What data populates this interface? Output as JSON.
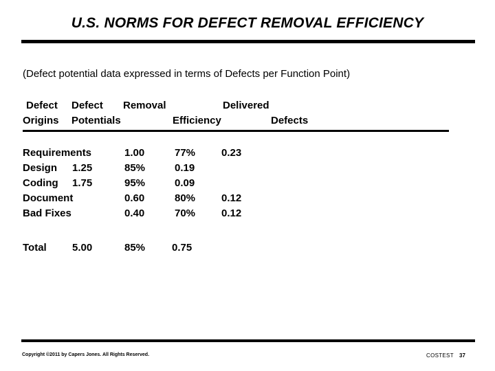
{
  "slide": {
    "title": "U.S. NORMS FOR DEFECT REMOVAL EFFICIENCY",
    "subtitle": "(Defect potential data expressed in terms of Defects per Function Point)",
    "background_color": "#ffffff",
    "text_color": "#000000"
  },
  "table": {
    "headers": {
      "row1": [
        "Defect",
        "Defect",
        "Removal",
        "Delivered"
      ],
      "row2": [
        "Origins",
        "Potentials",
        "Efficiency",
        "Defects"
      ],
      "col1_label": "Defect Origins",
      "col2_label": "Defect Potentials",
      "col3_label": "Removal Efficiency",
      "col4_label": "Delivered Defects"
    },
    "rows": [
      {
        "origin": "Requirements",
        "potential": "1.00",
        "efficiency": "77%",
        "delivered": "0.23",
        "inline_potential": false
      },
      {
        "origin": "Design",
        "potential": "1.25",
        "efficiency": "85%",
        "delivered": "0.19",
        "inline_potential": true
      },
      {
        "origin": "Coding",
        "potential": "1.75",
        "efficiency": "95%",
        "delivered": "0.09",
        "inline_potential": true
      },
      {
        "origin": "Document",
        "potential": "0.60",
        "efficiency": "80%",
        "delivered": "0.12",
        "inline_potential": false
      },
      {
        "origin": "Bad Fixes",
        "potential": "0.40",
        "efficiency": "70%",
        "delivered": "0.12",
        "inline_potential": false
      }
    ],
    "total": {
      "label": "Total",
      "potential": "5.00",
      "efficiency": "85%",
      "delivered": "0.75"
    }
  },
  "footer": {
    "copyright": "Copyright ©2011 by Capers Jones.  All Rights Reserved.",
    "document_code": "COSTEST",
    "page_number": "37"
  }
}
